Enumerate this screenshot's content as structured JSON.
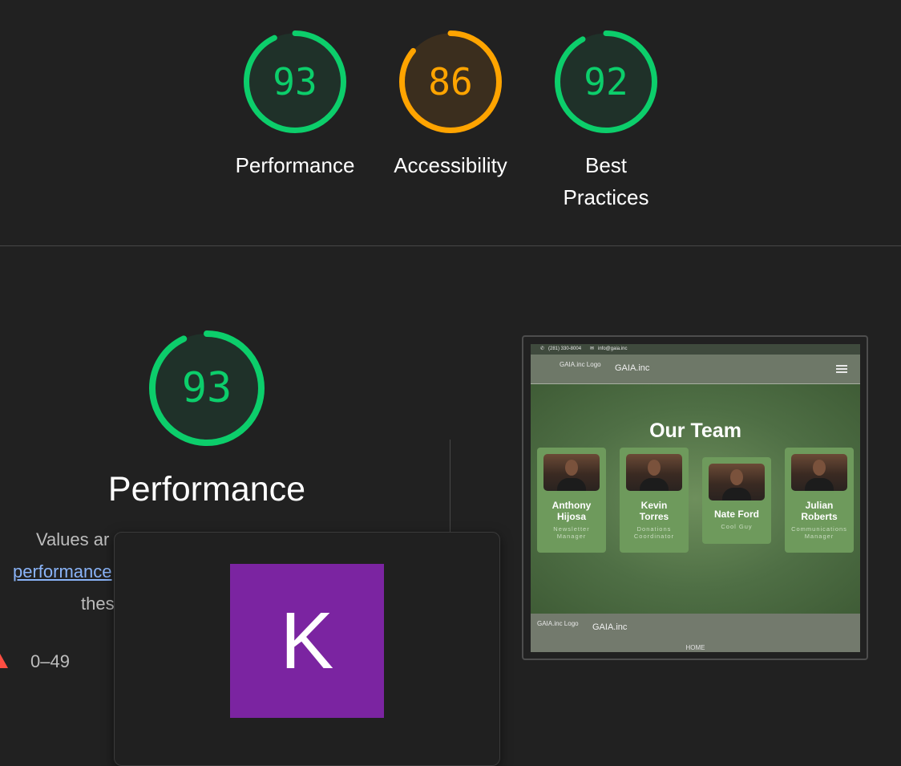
{
  "colors": {
    "pass": "#0cce6b",
    "pass_track": "#1f3129",
    "average": "#ffa400",
    "average_track": "#3b2e1e",
    "fail": "#ff4e42",
    "background": "#212121",
    "avatar": "#7b24a1"
  },
  "gauges": [
    {
      "score": "93",
      "label": "Performance",
      "status": "pass"
    },
    {
      "score": "86",
      "label": "Accessibility",
      "status": "average"
    },
    {
      "score": "92",
      "label_line1": "Best",
      "label_line2": "Practices",
      "status": "pass"
    }
  ],
  "performance_section": {
    "score": "93",
    "title": "Performance",
    "desc_line1": "Values ar",
    "desc_link": "performance",
    "desc_line3": "thes",
    "legend_fail_range": "0–49"
  },
  "tooltip": {
    "avatar_letter": "K"
  },
  "preview": {
    "phone": "(281) 330-8004",
    "email": "info@gaia.inc",
    "logo_alt": "GAIA.inc Logo",
    "brand": "GAIA.inc",
    "menu_icon": "hamburger-icon",
    "heading": "Our Team",
    "team": [
      {
        "name_line1": "Anthony",
        "name_line2": "Hijosa",
        "role_line1": "Newsletter",
        "role_line2": "Manager"
      },
      {
        "name_line1": "Kevin",
        "name_line2": "Torres",
        "role_line1": "Donations",
        "role_line2": "Coordinator"
      },
      {
        "name_line1": "Nate Ford",
        "name_line2": "",
        "role_line1": "Cool Guy",
        "role_line2": ""
      },
      {
        "name_line1": "Julian",
        "name_line2": "Roberts",
        "role_line1": "Communications",
        "role_line2": "Manager"
      }
    ],
    "footer_logo_alt": "GAIA.inc Logo",
    "footer_brand": "GAIA.inc",
    "footer_link": "HOME"
  }
}
